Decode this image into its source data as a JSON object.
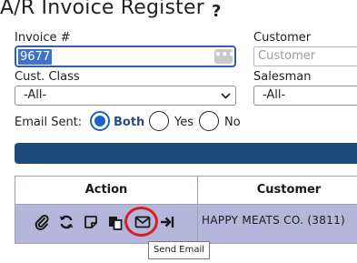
{
  "page": {
    "title": "A/R Invoice Register",
    "help_icon": "?"
  },
  "filters": {
    "invoice_label": "Invoice #",
    "invoice_value": "9677",
    "invoice_lookup_icon": "ellipsis-icon",
    "invoice_lookup_glyph": "•••",
    "customer_label": "Customer",
    "customer_placeholder": "Customer",
    "cust_class_label": "Cust. Class",
    "cust_class_value": "-All-",
    "salesman_label": "Salesman",
    "salesman_value": "-All-",
    "email_sent_label": "Email Sent:",
    "email_options": [
      {
        "label": "Both",
        "selected": true
      },
      {
        "label": "Yes",
        "selected": false
      },
      {
        "label": "No",
        "selected": false
      }
    ]
  },
  "colors": {
    "accent": "#1f63c8",
    "submit_bar": "#1d4b79",
    "row_highlight": "#b6b6dc",
    "annotation": "#d62020"
  },
  "table": {
    "columns": [
      "Action",
      "Customer"
    ],
    "rows": [
      {
        "actions": [
          "paperclip-icon",
          "refresh-icon",
          "note-icon",
          "copy-icon",
          "send-email-icon",
          "post-icon"
        ],
        "customer": "HAPPY MEATS CO. (3811)"
      }
    ]
  },
  "tooltip": {
    "text": "Send Email"
  }
}
